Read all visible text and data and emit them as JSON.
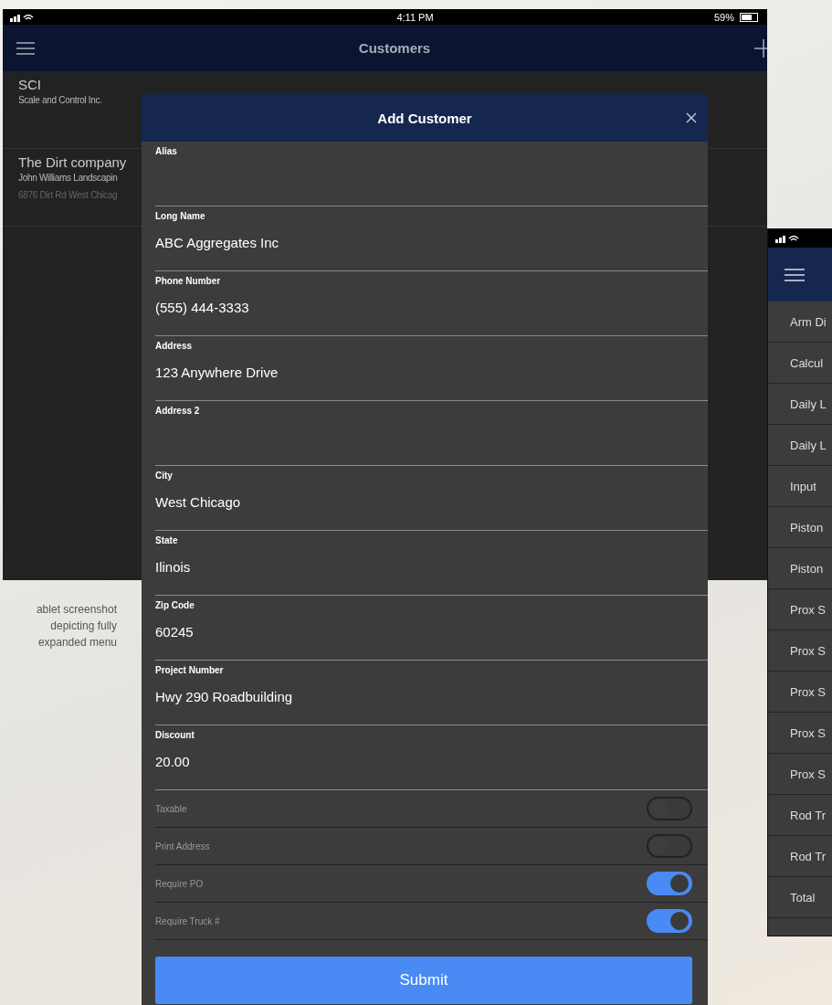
{
  "tablet": {
    "status_bar": {
      "time": "4:11 PM",
      "battery": "59%"
    },
    "title": "Customers",
    "customers": [
      {
        "name": "SCI",
        "long_name": "Scale and Control Inc."
      },
      {
        "name": "The Dirt company",
        "long_name": "John Williams Landscapin",
        "address": "6876 Dirt Rd West Chicag"
      }
    ]
  },
  "caption": [
    "ablet screenshot",
    "depicting fully",
    "expanded menu"
  ],
  "modal": {
    "title": "Add Customer",
    "fields": [
      {
        "label": "Alias"
      },
      {
        "label": "Long Name",
        "value": "ABC Aggregates Inc"
      },
      {
        "label": "Phone Number",
        "value": "(555) 444-3333"
      },
      {
        "label": "Address",
        "value": "123 Anywhere Drive"
      },
      {
        "label": "Address 2"
      },
      {
        "label": "City",
        "value": "West Chicago"
      },
      {
        "label": "State",
        "value": "Ilinois"
      },
      {
        "label": "Zip Code",
        "value": "60245"
      },
      {
        "label": "Project Number",
        "value": "Hwy 290 Roadbuilding"
      },
      {
        "label": "Discount",
        "value": "20.00"
      }
    ],
    "toggles": [
      {
        "label": "Taxable",
        "on": false
      },
      {
        "label": "Print Address",
        "on": false
      },
      {
        "label": "Require PO",
        "on": true
      },
      {
        "label": "Require Truck #",
        "on": true
      }
    ],
    "submit": "Submit"
  },
  "phone": {
    "menu": [
      "Arm Di",
      "Calcul",
      "Daily L",
      "Daily L",
      "Input",
      "Piston",
      "Piston",
      "Prox S",
      "Prox S",
      "Prox S",
      "Prox S",
      "Prox S",
      "Rod Tr",
      "Rod Tr",
      "Total"
    ]
  }
}
